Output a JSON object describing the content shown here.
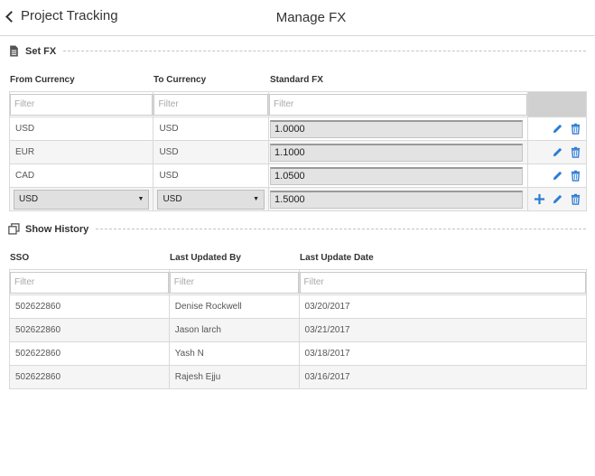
{
  "header": {
    "back_label": "Project Tracking",
    "title": "Manage FX"
  },
  "set_fx": {
    "section_label": "Set FX",
    "columns": [
      "From Currency",
      "To Currency",
      "Standard FX"
    ],
    "filter_placeholder": "Filter",
    "rows": [
      {
        "from": "USD",
        "to": "USD",
        "fx": "1.0000"
      },
      {
        "from": "EUR",
        "to": "USD",
        "fx": "1.1000"
      },
      {
        "from": "CAD",
        "to": "USD",
        "fx": "1.0500"
      }
    ],
    "new_row": {
      "from": "USD",
      "to": "USD",
      "fx": "1.5000"
    }
  },
  "history": {
    "section_label": "Show History",
    "columns": [
      "SSO",
      "Last Updated By",
      "Last Update Date"
    ],
    "filter_placeholder": "Filter",
    "rows": [
      {
        "sso": "502622860",
        "by": "Denise Rockwell",
        "date": "03/20/2017"
      },
      {
        "sso": "502622860",
        "by": "Jason larch",
        "date": "03/21/2017"
      },
      {
        "sso": "502622860",
        "by": "Yash N",
        "date": "03/18/2017"
      },
      {
        "sso": "502622860",
        "by": "Rajesh Ejju",
        "date": "03/16/2017"
      }
    ]
  },
  "colors": {
    "icon_blue": "#2b7bd4",
    "header_gray": "#d0d0d0",
    "row_alt": "#f5f5f5"
  },
  "icons": {
    "edit": "pencil-icon",
    "delete": "trash-icon",
    "add": "plus-icon",
    "set_fx": "document-icon",
    "history": "copy-icon",
    "back": "chevron-left-icon"
  }
}
